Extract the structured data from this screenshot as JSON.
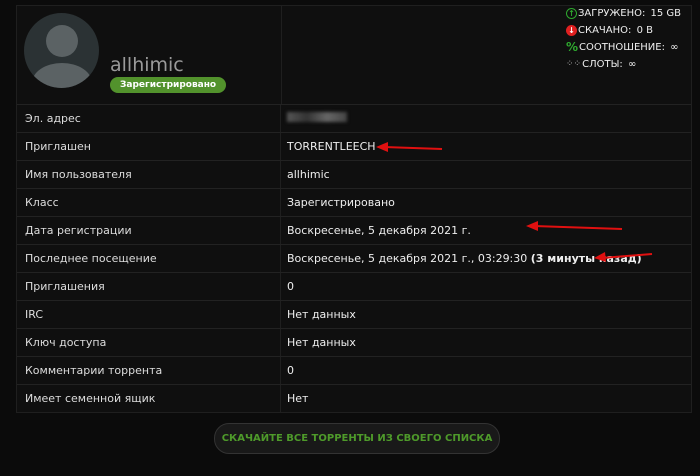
{
  "profile": {
    "username": "allhimic",
    "badge": "Зарегистрировано"
  },
  "stats": [
    {
      "icon": "upload-icon",
      "label": "ЗАГРУЖЕНО:",
      "value": "15 GB",
      "color": "#2ea82e"
    },
    {
      "icon": "download-icon",
      "label": "СКАЧАНО:",
      "value": "0 B",
      "color": "#e02020"
    },
    {
      "icon": "percent-icon",
      "label": "СООТНОШЕНИЕ:",
      "value": "∞",
      "color": "#2ea82e"
    },
    {
      "icon": "slots-icon",
      "label": "СЛОТЫ:",
      "value": "∞",
      "color": "#bbbbbb"
    }
  ],
  "rows": [
    {
      "key": "Эл. адрес",
      "value": ""
    },
    {
      "key": "Приглашен",
      "value": "TORRENTLEECH"
    },
    {
      "key": "Имя пользователя",
      "value": "allhimic"
    },
    {
      "key": "Класс",
      "value": "Зарегистрировано"
    },
    {
      "key": "Дата регистрации",
      "value": "Воскресенье, 5 декабря 2021 г."
    },
    {
      "key": "Последнее посещение",
      "value": "Воскресенье, 5 декабря 2021 г., 03:29:30",
      "extra": "(3 минуты назад)"
    },
    {
      "key": "Приглашения",
      "value": "0"
    },
    {
      "key": "IRC",
      "value": "Нет данных"
    },
    {
      "key": "Ключ доступа",
      "value": "Нет данных"
    },
    {
      "key": "Комментарии торрента",
      "value": "0"
    },
    {
      "key": "Имеет семенной ящик",
      "value": "Нет"
    }
  ],
  "button": {
    "label": "СКАЧАЙТЕ ВСЕ ТОРРЕНТЫ ИЗ СВОЕГО СПИСКА"
  },
  "colors": {
    "accent": "#52922c",
    "annotation": "#e01010"
  }
}
